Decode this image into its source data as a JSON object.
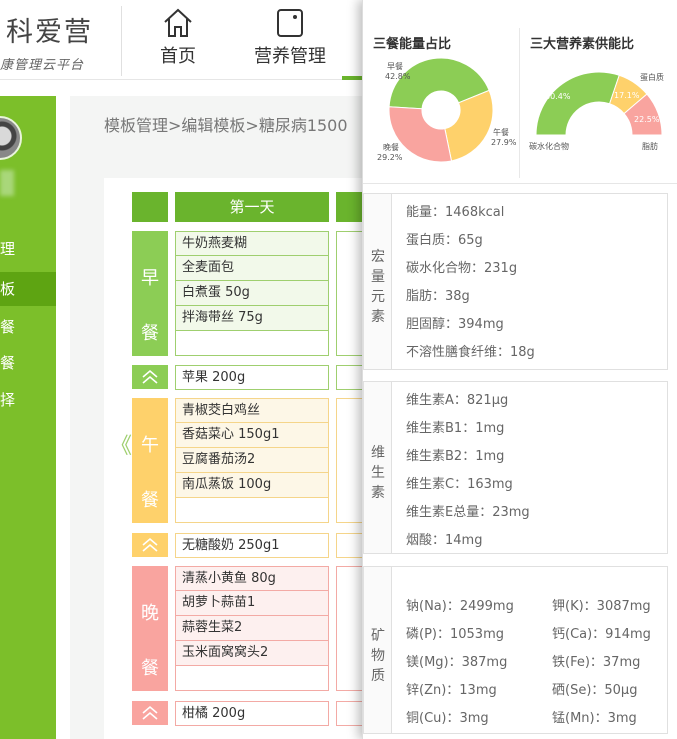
{
  "header": {
    "logo_text": "科爱营",
    "logo_sub": "康管理云平台",
    "nav": [
      {
        "label": "首页",
        "icon": "home-icon"
      },
      {
        "label": "营养管理",
        "icon": "clipboard-icon"
      }
    ]
  },
  "sidebar": {
    "items": [
      {
        "label": "理",
        "active": false
      },
      {
        "label": "板",
        "active": true
      },
      {
        "label": "餐",
        "active": false
      },
      {
        "label": "餐",
        "active": false
      },
      {
        "label": "择",
        "active": false
      }
    ]
  },
  "breadcrumb": "模板管理>编辑模板>糖尿病1500",
  "day": {
    "label": "第一天"
  },
  "meals": {
    "breakfast": {
      "tag": [
        "早",
        "餐"
      ],
      "foods": [
        "牛奶燕麦糊",
        "全麦面包",
        "白煮蛋 50g",
        "拌海带丝 75g",
        ""
      ],
      "snack": "苹果 200g"
    },
    "lunch": {
      "tag": [
        "午",
        "餐"
      ],
      "foods": [
        "青椒茭白鸡丝",
        "香菇菜心 150g1",
        "豆腐番茄汤2",
        "南瓜蒸饭 100g",
        ""
      ],
      "snack": "无糖酸奶 250g1"
    },
    "dinner": {
      "tag": [
        "晚",
        "餐"
      ],
      "foods": [
        "清蒸小黄鱼 80g",
        "胡萝卜蒜苗1",
        "蒜蓉生菜2",
        "玉米面窝窝头2",
        ""
      ],
      "snack": "柑橘 200g"
    }
  },
  "prev_arrow": "《",
  "charts": {
    "meal_energy": {
      "title": "三餐能量占比",
      "labels": [
        {
          "name": "早餐",
          "pct": "42.8%"
        },
        {
          "name": "午餐",
          "pct": "27.9%"
        },
        {
          "name": "晚餐",
          "pct": "29.2%"
        }
      ]
    },
    "macro": {
      "title": "三大营养素供能比",
      "labels": [
        {
          "name": "碳水化合物",
          "pct": "60.4%"
        },
        {
          "name": "蛋白质",
          "pct": "17.1%"
        },
        {
          "name": "脂肪",
          "pct": "22.5%"
        }
      ]
    }
  },
  "chart_data": [
    {
      "type": "pie",
      "title": "三餐能量占比",
      "categories": [
        "早餐",
        "午餐",
        "晚餐"
      ],
      "values": [
        42.8,
        27.9,
        29.2
      ],
      "colors": [
        "#8ccd55",
        "#fed16b",
        "#f9a49f"
      ]
    },
    {
      "type": "pie",
      "title": "三大营养素供能比",
      "categories": [
        "碳水化合物",
        "蛋白质",
        "脂肪"
      ],
      "values": [
        60.4,
        17.1,
        22.5
      ],
      "colors": [
        "#8ccd55",
        "#fed16b",
        "#f9a49f"
      ]
    }
  ],
  "nutrients": {
    "macro": {
      "label": [
        "宏",
        "量",
        "元",
        "素"
      ],
      "rows": [
        "能量：1468kcal",
        "蛋白质：65g",
        "碳水化合物：231g",
        "脂肪：38g",
        "胆固醇：394mg",
        "不溶性膳食纤维：18g"
      ]
    },
    "vitamin": {
      "label": [
        "维",
        "生",
        "素"
      ],
      "rows": [
        "维生素A：821μg",
        "维生素B1：1mg",
        "维生素B2：1mg",
        "维生素C：163mg",
        "维生素E总量：23mg",
        "烟酸：14mg"
      ]
    },
    "mineral": {
      "label": [
        "矿",
        "物",
        "质"
      ],
      "left": [
        "钠(Na)：2499mg",
        "磷(P)：1053mg",
        "镁(Mg)：387mg",
        "锌(Zn)：13mg",
        "铜(Cu)：3mg"
      ],
      "right": [
        "钾(K)：3087mg",
        "钙(Ca)：914mg",
        "铁(Fe)：37mg",
        "硒(Se)：50μg",
        "锰(Mn)：3mg"
      ]
    }
  },
  "colors": {
    "brand_green": "#6ab42d",
    "sidebar_green": "#7cbf2a",
    "orange": "#fed16b",
    "pink": "#f9a49f"
  }
}
